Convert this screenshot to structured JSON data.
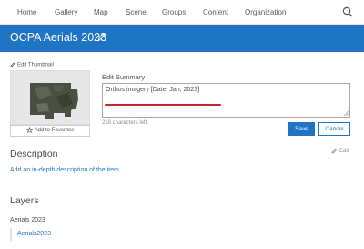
{
  "nav": {
    "items": [
      {
        "label": "Home"
      },
      {
        "label": "Gallery"
      },
      {
        "label": "Map"
      },
      {
        "label": "Scene"
      },
      {
        "label": "Groups"
      },
      {
        "label": "Content"
      },
      {
        "label": "Organization"
      }
    ],
    "search_icon": "search-icon"
  },
  "banner": {
    "title": "OCPA Aerials 2023",
    "edit_icon": "pencil-icon",
    "color": "#1f74c4"
  },
  "thumbnail": {
    "edit_label": "Edit Thumbnail",
    "favorite_label": "Add to Favorites"
  },
  "summary": {
    "label": "Edit Summary",
    "value": "Orthos imagery [Date: Jan, 2023]",
    "chars_left": "218 characters left.",
    "underline_color": "#c6282e"
  },
  "actions": {
    "save_label": "Save",
    "cancel_label": "Cancel"
  },
  "description": {
    "title": "Description",
    "edit_label": "Edit",
    "link_text": "Add an in-depth description of the item."
  },
  "layers": {
    "title": "Layers",
    "subtitle": "Aerials 2023",
    "items": [
      {
        "label": "Aerials2023"
      }
    ]
  }
}
